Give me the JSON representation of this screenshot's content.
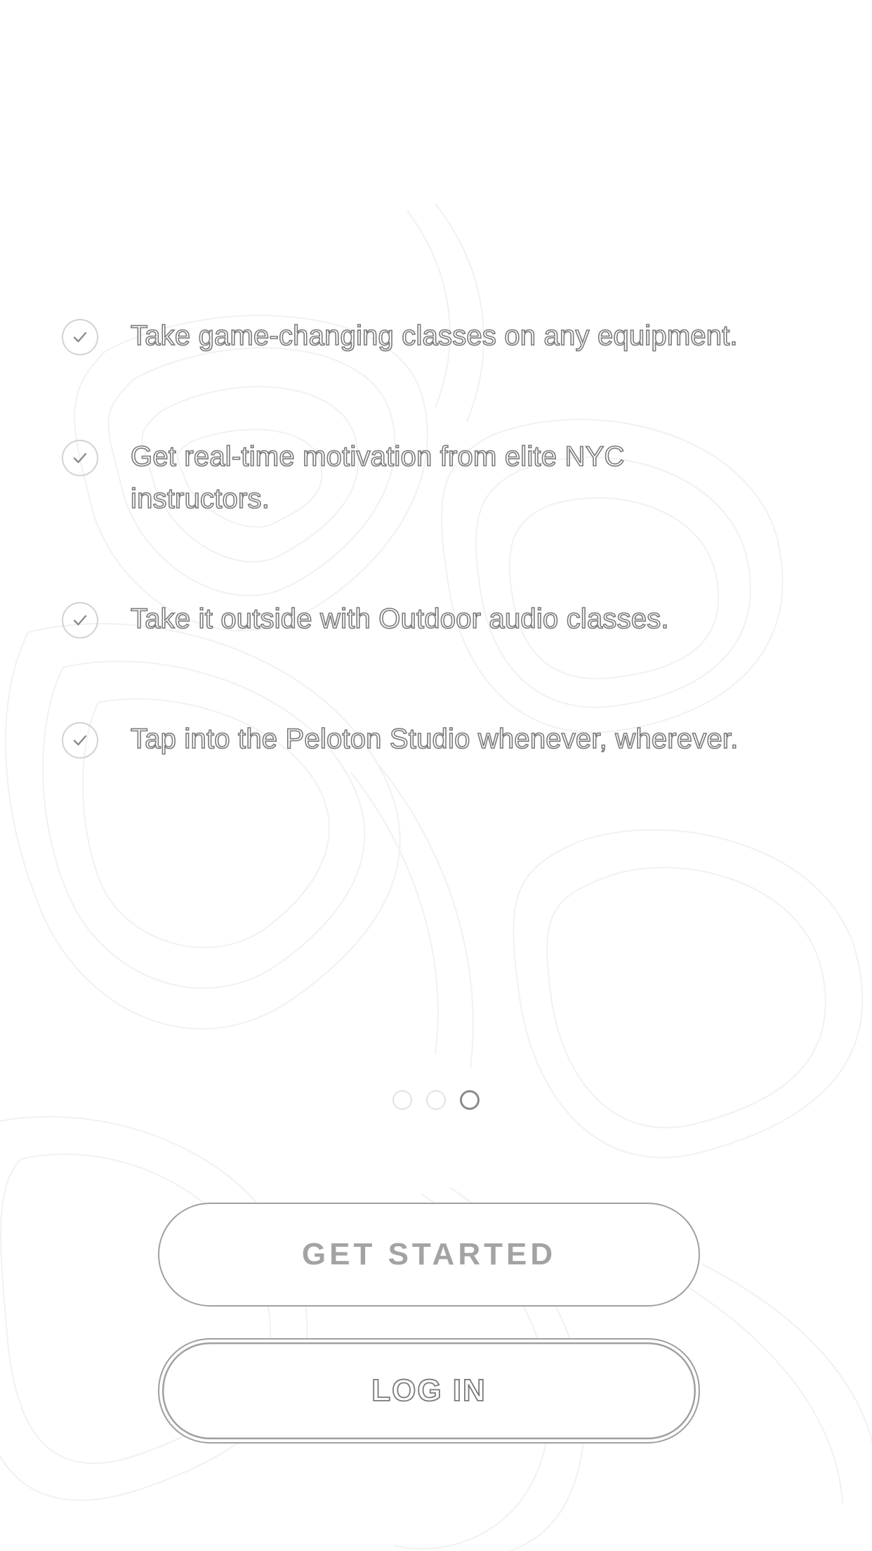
{
  "features": [
    {
      "text": "Take game-changing classes on any equipment.",
      "icon": "check-circle-icon"
    },
    {
      "text": "Get real-time motivation from elite NYC instructors.",
      "icon": "check-circle-icon"
    },
    {
      "text": "Take it outside with Outdoor audio classes.",
      "icon": "check-circle-icon"
    },
    {
      "text": "Tap into the Peloton Studio whenever, wherever.",
      "icon": "check-circle-icon"
    }
  ],
  "pagination": {
    "count": 3,
    "active_index": 2
  },
  "buttons": {
    "get_started_label": "GET STARTED",
    "log_in_label": "LOG IN"
  },
  "colors": {
    "background": "#ffffff",
    "outline": "#7a7a7a",
    "button_border": "#a0a0a0"
  }
}
